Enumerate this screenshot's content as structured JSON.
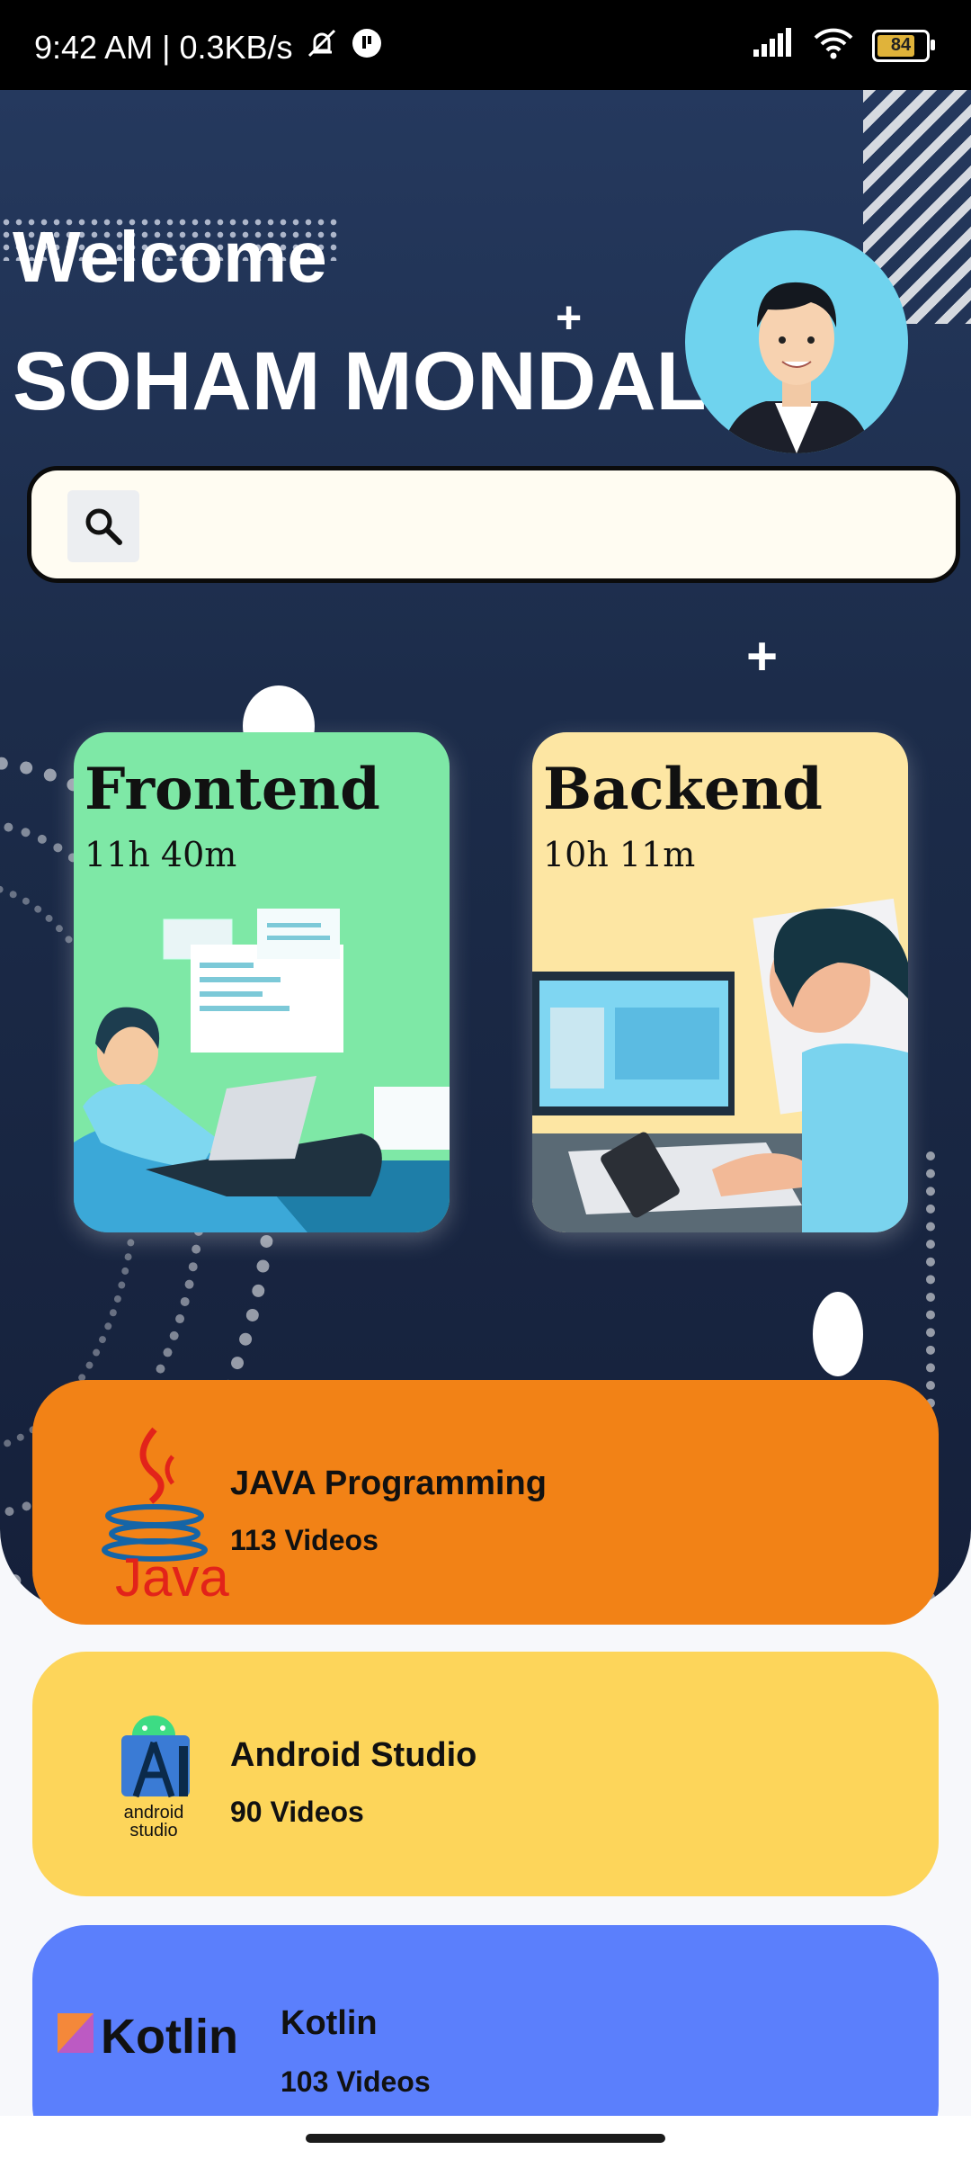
{
  "status_bar": {
    "time_speed": "9:42 AM | 0.3KB/s",
    "battery": "84"
  },
  "header": {
    "welcome": "Welcome",
    "username": "SOHAM MONDAL"
  },
  "search": {
    "placeholder": ""
  },
  "categories": [
    {
      "title": "Frontend",
      "duration": "11h 40m",
      "color": "#7ee8a6"
    },
    {
      "title": "Backend",
      "duration": "10h 11m",
      "color": "#fde6a3"
    }
  ],
  "courses": [
    {
      "title": "JAVA Programming",
      "count": "113 Videos",
      "color": "#f28216",
      "logo": "java-logo"
    },
    {
      "title": "Android Studio",
      "count": "90 Videos",
      "color": "#fdd55a",
      "logo": "android-studio-logo",
      "logo_text": "android studio"
    },
    {
      "title": "Kotlin",
      "count": "103 Videos",
      "color": "#5b7ffc",
      "logo": "kotlin-logo",
      "logo_text": "Kotlin"
    }
  ],
  "java_logo_text": "Java"
}
